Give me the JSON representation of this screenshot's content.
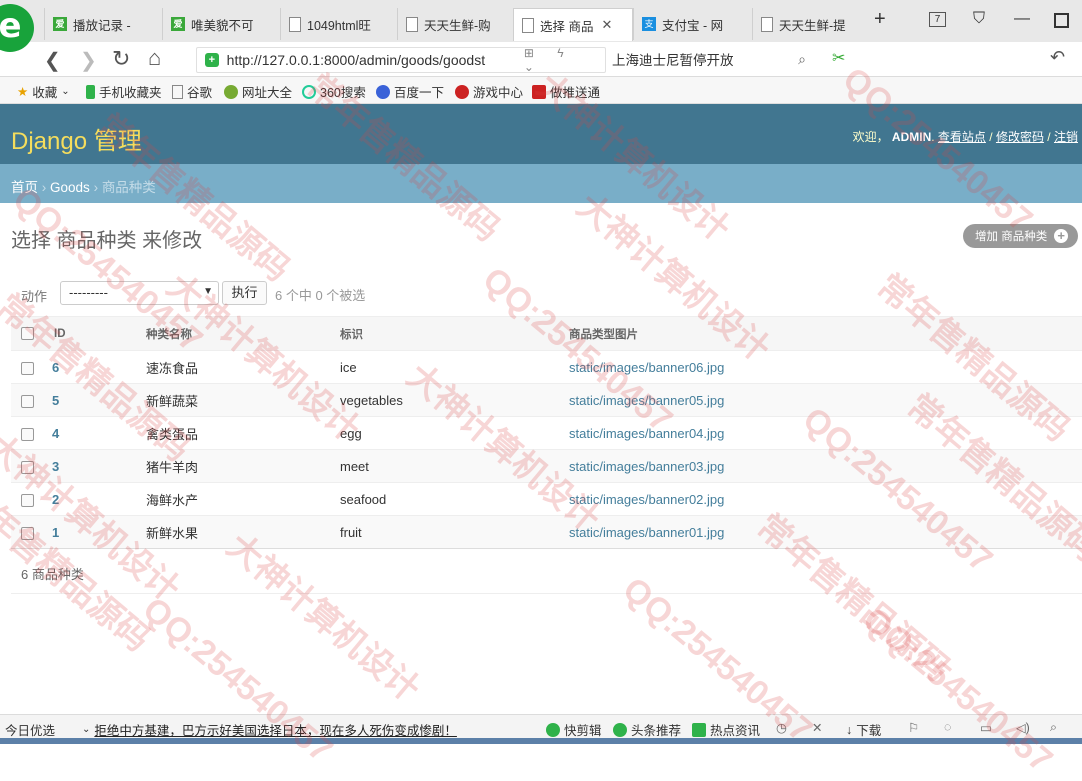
{
  "browser": {
    "tabs": [
      {
        "title": "播放记录 -",
        "icon": "iqiyi-icon"
      },
      {
        "title": "唯美貌不可",
        "icon": "iqiyi-icon"
      },
      {
        "title": "1049html旺",
        "icon": "document-icon"
      },
      {
        "title": "天天生鲜-购",
        "icon": "document-icon"
      },
      {
        "title": "选择 商品",
        "icon": "document-icon"
      },
      {
        "title": "支付宝 - 网",
        "icon": "alipay-icon"
      },
      {
        "title": "天天生鲜-提",
        "icon": "document-icon"
      }
    ],
    "tab_count_badge": "7",
    "address": "http://127.0.0.1:8000/admin/goods/goodst",
    "search_text": "上海迪士尼暂停开放",
    "bookmarks": [
      {
        "label": "收藏",
        "icon": "star-icon"
      },
      {
        "label": "手机收藏夹",
        "icon": "phone-icon"
      },
      {
        "label": "谷歌",
        "icon": "document-icon"
      },
      {
        "label": "网址大全",
        "icon": "compass-icon"
      },
      {
        "label": "360搜索",
        "icon": "360-search-icon"
      },
      {
        "label": "百度一下",
        "icon": "baidu-icon"
      },
      {
        "label": "游戏中心",
        "icon": "game-icon"
      },
      {
        "label": "做推送通",
        "icon": "app-icon"
      }
    ]
  },
  "admin": {
    "branding": "Django 管理",
    "welcome": "欢迎，",
    "username": "ADMIN",
    "links": [
      "查看站点",
      "修改密码",
      "注销"
    ],
    "breadcrumbs": [
      "首页",
      "Goods",
      "商品种类"
    ],
    "page_title": "选择 商品种类 来修改",
    "add_button": "增加 商品种类",
    "actions_label": "动作",
    "action_selected": "---------",
    "go_button": "执行",
    "selection_counter": "6 个中 0 个被选",
    "columns": [
      "ID",
      "种类名称",
      "标识",
      "商品类型图片"
    ],
    "rows": [
      {
        "id": "6",
        "name": "速冻食品",
        "logo": "ice",
        "image": "static/images/banner06.jpg"
      },
      {
        "id": "5",
        "name": "新鲜蔬菜",
        "logo": "vegetables",
        "image": "static/images/banner05.jpg"
      },
      {
        "id": "4",
        "name": "禽类蛋品",
        "logo": "egg",
        "image": "static/images/banner04.jpg"
      },
      {
        "id": "3",
        "name": "猪牛羊肉",
        "logo": "meet",
        "image": "static/images/banner03.jpg"
      },
      {
        "id": "2",
        "name": "海鲜水产",
        "logo": "seafood",
        "image": "static/images/banner02.jpg"
      },
      {
        "id": "1",
        "name": "新鲜水果",
        "logo": "fruit",
        "image": "static/images/banner01.jpg"
      }
    ],
    "result_count": "6 商品种类"
  },
  "statusbar": {
    "left": "今日优选",
    "news": "拒绝中方基建，巴方示好美国选择日本，现在多人死伤变成惨剧！",
    "items": [
      "快剪辑",
      "头条推荐",
      "热点资讯",
      "下载"
    ]
  },
  "watermark": [
    "大神计算机设计",
    "QQ:254540457",
    "常年售精品源码"
  ],
  "colors": {
    "header": "#417690",
    "breadcrumbs": "#79aec8",
    "branding": "#f5dd5d",
    "link": "#447e9b"
  }
}
